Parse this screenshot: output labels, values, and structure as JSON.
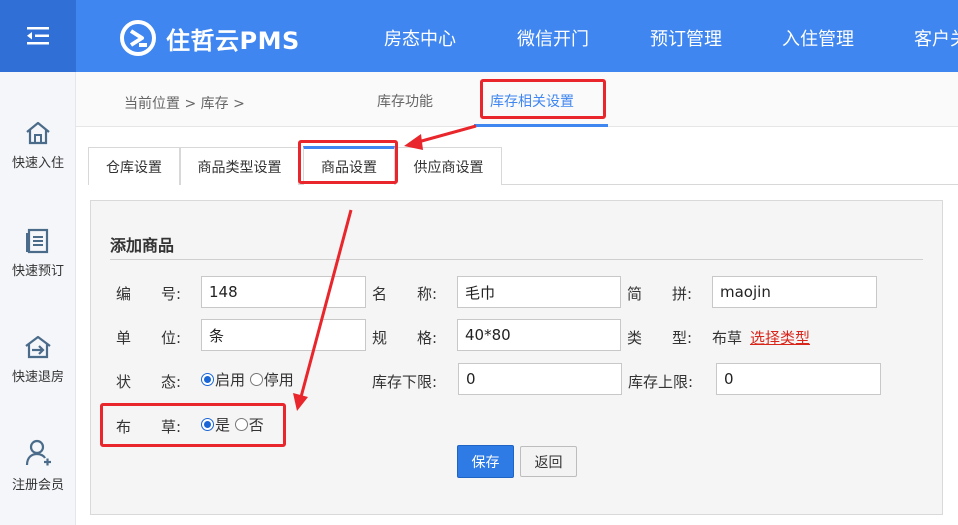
{
  "app": {
    "logo_text": "住哲云PMS",
    "accent_color": "#3f86f0",
    "annotation_color": "#e8262b"
  },
  "topnav": {
    "items": [
      "房态中心",
      "微信开门",
      "预订管理",
      "入住管理",
      "客户关"
    ]
  },
  "sidebar": {
    "items": [
      {
        "label": "快速入住",
        "icon": "home-icon"
      },
      {
        "label": "快速预订",
        "icon": "document-list-icon"
      },
      {
        "label": "快速退房",
        "icon": "checkout-arrow-icon"
      },
      {
        "label": "注册会员",
        "icon": "user-add-icon"
      }
    ]
  },
  "breadcrumb": {
    "text": "当前位置 > 库存 >"
  },
  "function_tabs": {
    "items": [
      "库存功能",
      "库存相关设置"
    ],
    "active": "库存相关设置"
  },
  "sub_tabs": {
    "items": [
      "仓库设置",
      "商品类型设置",
      "商品设置",
      "供应商设置"
    ],
    "active": "商品设置"
  },
  "form": {
    "title": "添加商品",
    "code_label": "编　　号:",
    "code_value": "148",
    "name_label": "名　　称:",
    "name_value": "毛巾",
    "pinyin_label": "简　　拼:",
    "pinyin_value": "maojin",
    "unit_label": "单　　位:",
    "unit_value": "条",
    "spec_label": "规　　格:",
    "spec_value": "40*80",
    "type_label": "类　　型:",
    "type_value": "布草",
    "type_link": "选择类型",
    "status_label": "状　　态:",
    "status_on": "启用",
    "status_off": "停用",
    "status_selected": "启用",
    "min_stock_label": "库存下限:",
    "min_stock_value": "0",
    "max_stock_label": "库存上限:",
    "max_stock_value": "0",
    "linen_label": "布　　草:",
    "linen_yes": "是",
    "linen_no": "否",
    "linen_selected": "是",
    "save_label": "保存",
    "back_label": "返回"
  }
}
